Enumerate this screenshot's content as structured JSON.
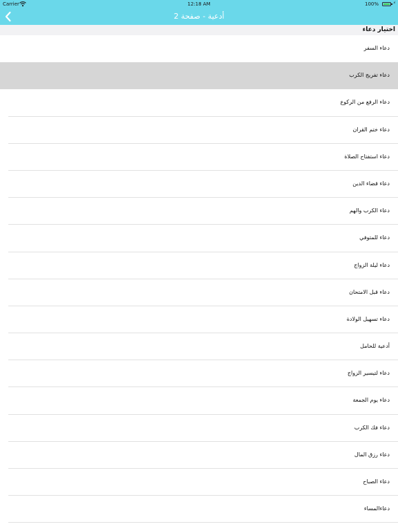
{
  "status_bar": {
    "carrier": "Carrier",
    "time": "12:18 AM",
    "battery_percent": "100%",
    "battery_level": 1.0,
    "icons": [
      "wifi-icon",
      "battery-icon",
      "charging-bolt-icon"
    ]
  },
  "nav_bar": {
    "title": "أدعية - صفحة 2",
    "back_icon": "chevron-left-icon",
    "background_color": "#6ad8ea"
  },
  "section": {
    "title": "اختيار دعاء"
  },
  "list": {
    "selected_index": 1,
    "items": [
      "دعاء السفر",
      "دعاء تفريج الكرب",
      "دعاء الرفع من الركوع",
      "دعاء ختم القران",
      "دعاء استفتاح الصلاة",
      "دعاء قضاء الدين",
      "دعاء الكرب والهم",
      "دعاء للمتوفي",
      "دعاء ليلة الزواج",
      "دعاء قبل الامتحان",
      "دعاء تسهيل الولادة",
      "أدعية للحامل",
      "دعاء لتيسير الزواج",
      "دعاء يوم الجمعة",
      "دعاء فك الكرب",
      "دعاء رزق المال",
      "دعاء الصباح",
      "دعاءالمساء"
    ]
  }
}
